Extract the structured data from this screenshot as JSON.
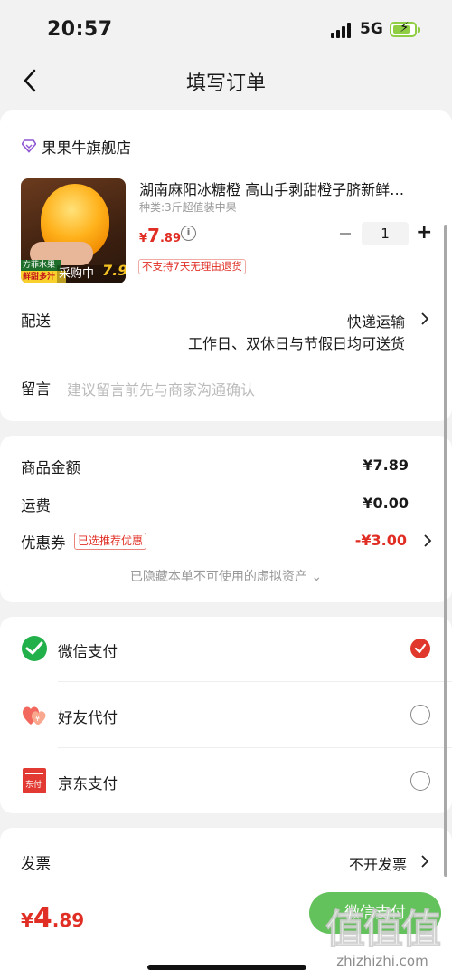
{
  "status_bar": {
    "time": "20:57",
    "network": "5G"
  },
  "nav": {
    "title": "填写订单"
  },
  "shop": {
    "name": "果果牛旗舰店"
  },
  "product": {
    "title": "湖南麻阳冰糖橙 高山手剥甜橙子脐新鲜…",
    "spec": "种类:3斤超值装中果",
    "price_symbol": "¥",
    "price_int": "7",
    "price_dec": ".89",
    "quantity": "1",
    "no_return_tag": "不支持7天无理由退货",
    "thumb": {
      "badge_top": "方菲水果",
      "badge_bottom": "鲜甜多汁",
      "overlay": "采购中",
      "promo_price": "7.9"
    }
  },
  "delivery": {
    "label": "配送",
    "method": "快递运输",
    "schedule": "工作日、双休日与节假日均可送货"
  },
  "remark": {
    "label": "留言",
    "placeholder": "建议留言前先与商家沟通确认"
  },
  "summary": {
    "goods_label": "商品金额",
    "goods_value": "¥7.89",
    "shipping_label": "运费",
    "shipping_value": "¥0.00",
    "coupon_label": "优惠券",
    "coupon_tag": "已选推荐优惠",
    "coupon_value": "-¥3.00",
    "hidden_assets": "已隐藏本单不可使用的虚拟资产 ⌄"
  },
  "payment": {
    "options": [
      {
        "label": "微信支付",
        "icon": "wechat-pay-icon",
        "selected": true
      },
      {
        "label": "好友代付",
        "icon": "friend-pay-icon",
        "selected": false
      },
      {
        "label": "京东支付",
        "icon": "jd-pay-icon",
        "selected": false
      }
    ]
  },
  "invoice": {
    "label": "发票",
    "value": "不开发票"
  },
  "footer": {
    "total_symbol": "¥",
    "total_int": "4",
    "total_dec": ".89",
    "pay_button": "微信支付"
  },
  "watermark": {
    "main": "值值值",
    "sub": "zhizhizhi.com"
  },
  "colors": {
    "accent_red": "#e02e24",
    "wechat_green": "#64c25c",
    "background": "#f2f2f2"
  }
}
